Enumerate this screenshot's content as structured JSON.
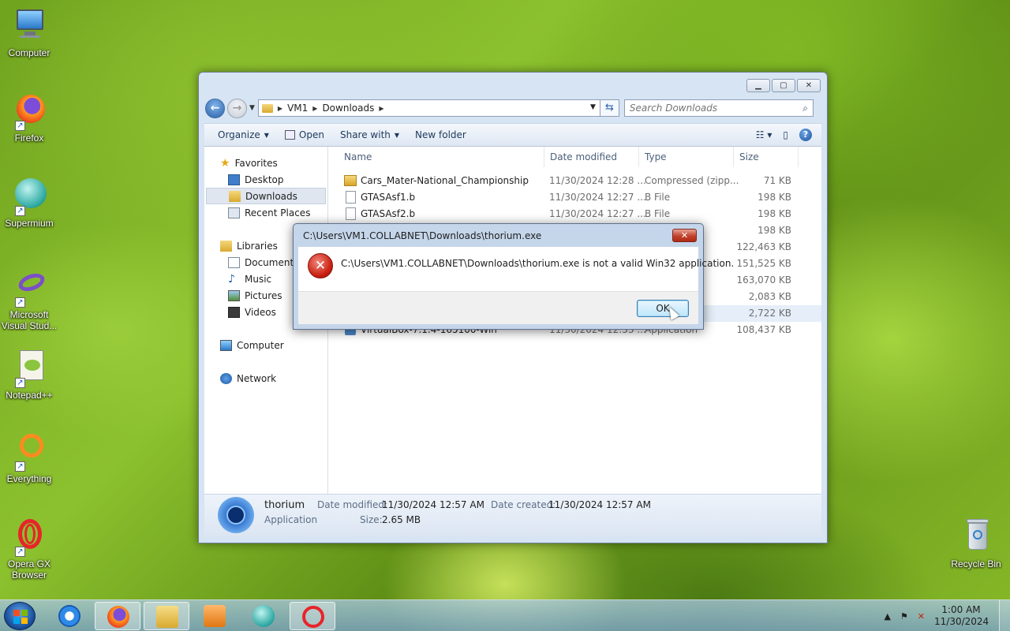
{
  "desktop": {
    "icons": [
      {
        "label": "Computer",
        "icon": "computer-icon"
      },
      {
        "label": "Firefox",
        "icon": "firefox-icon"
      },
      {
        "label": "Supermium",
        "icon": "supermium-icon"
      },
      {
        "label": "Microsoft Visual Stud...",
        "icon": "visual-studio-icon"
      },
      {
        "label": "Notepad++",
        "icon": "notepadpp-icon"
      },
      {
        "label": "Everything",
        "icon": "everything-icon"
      },
      {
        "label": "Opera GX Browser",
        "icon": "opera-gx-icon"
      },
      {
        "label": "Recycle Bin",
        "icon": "recycle-bin-icon"
      }
    ]
  },
  "explorer": {
    "breadcrumb": [
      "VM1",
      "Downloads"
    ],
    "search_placeholder": "Search Downloads",
    "toolbar": {
      "organize": "Organize",
      "open": "Open",
      "share_with": "Share with",
      "new_folder": "New folder"
    },
    "nav": {
      "favorites": "Favorites",
      "desktop": "Desktop",
      "downloads": "Downloads",
      "recent_places": "Recent Places",
      "libraries": "Libraries",
      "documents": "Documents",
      "music": "Music",
      "pictures": "Pictures",
      "videos": "Videos",
      "computer": "Computer",
      "network": "Network"
    },
    "columns": {
      "name": "Name",
      "date": "Date modified",
      "type": "Type",
      "size": "Size"
    },
    "files": [
      {
        "name": "Cars_Mater-National_Championship",
        "date": "11/30/2024 12:28 ...",
        "type": "Compressed (zipp...",
        "size": "71 KB"
      },
      {
        "name": "GTASAsf1.b",
        "date": "11/30/2024 12:27 ...",
        "type": "B File",
        "size": "198 KB"
      },
      {
        "name": "GTASAsf2.b",
        "date": "11/30/2024 12:27 ...",
        "type": "B File",
        "size": "198 KB"
      }
    ],
    "hidden_rows": [
      {
        "size": "198 KB"
      },
      {
        "size": "122,463 KB"
      },
      {
        "size": "151,525 KB"
      },
      {
        "size": "163,070 KB"
      },
      {
        "size": "2,083 KB"
      },
      {
        "size": "2,722 KB"
      },
      {
        "name": "VirtualBox-7.1.4-165100-Win",
        "date": "11/30/2024 12:53 ...",
        "type": "Application",
        "size": "108,437 KB"
      }
    ],
    "details": {
      "name": "thorium",
      "kind": "Application",
      "date_modified_label": "Date modified:",
      "date_modified": "11/30/2024 12:57 AM",
      "size_label": "Size:",
      "size": "2.65 MB",
      "date_created_label": "Date created:",
      "date_created": "11/30/2024 12:57 AM"
    }
  },
  "dialog": {
    "title": "C:\\Users\\VM1.COLLABNET\\Downloads\\thorium.exe",
    "message": "C:\\Users\\VM1.COLLABNET\\Downloads\\thorium.exe is not a valid Win32 application.",
    "ok": "OK"
  },
  "taskbar": {
    "time": "1:00 AM",
    "date": "11/30/2024",
    "apps": [
      "internet-explorer-icon",
      "firefox-icon",
      "file-explorer-icon",
      "media-player-icon",
      "supermium-icon",
      "opera-gx-icon"
    ]
  }
}
